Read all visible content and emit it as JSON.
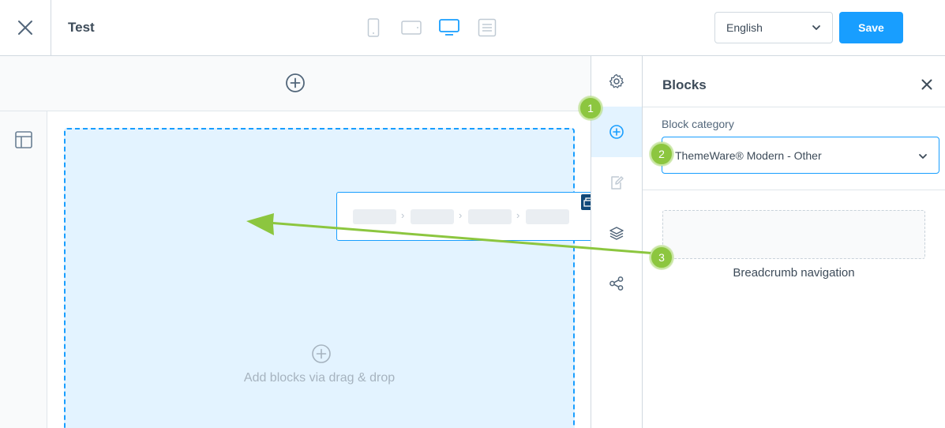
{
  "topbar": {
    "page_name": "Test",
    "devices": [
      "mobile",
      "tablet",
      "desktop",
      "form"
    ],
    "active_device": "desktop",
    "language": "English",
    "save_label": "Save"
  },
  "canvas": {
    "drop_text": "Add blocks via drag & drop"
  },
  "sidebar_tabs": [
    "settings-icon",
    "add-block-icon",
    "edit-icon",
    "layers-icon",
    "share-icon"
  ],
  "panel": {
    "title": "Blocks",
    "category_label": "Block category",
    "category_value": "ThemeWare® Modern - Other",
    "block_name": "Breadcrumb navigation"
  },
  "annotations": {
    "step1": "1",
    "step2": "2",
    "step3": "3"
  },
  "colors": {
    "accent": "#189eff",
    "annotation": "#8cc63f",
    "drop_bg": "#e3f3ff"
  }
}
